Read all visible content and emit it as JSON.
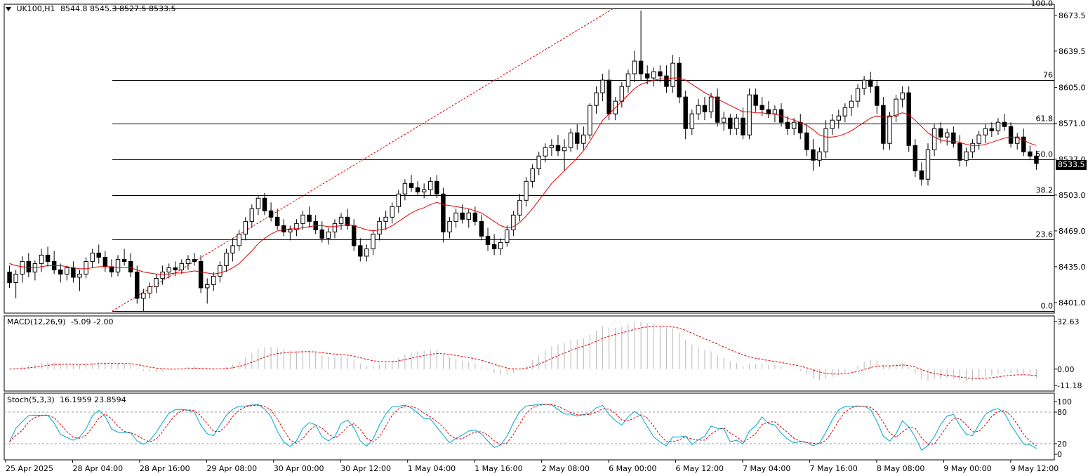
{
  "header": {
    "symbol": "UK100,H1",
    "ohlc": "8544.8 8545.3 8527.5 8533.5"
  },
  "last_price_tag": "8533.5",
  "macd": {
    "label": "MACD(12,26,9)",
    "values": "-5.09 -2.00"
  },
  "stoch": {
    "label": "Stoch(5,3,3)",
    "values": "16.1959 23.8594"
  },
  "colors": {
    "ma": "#e00000",
    "macd_signal": "#e00000",
    "macd_hist": "#b8b8b8",
    "stoch_main": "#00a6c8",
    "stoch_signal": "#e00000",
    "fib": "#000000",
    "trend": "#e00000"
  },
  "chart_data": [
    {
      "type": "candlestick",
      "title": "UK100,H1",
      "price_axis_ticks": [
        "8673.5",
        "8639.5",
        "8605.0",
        "8571.0",
        "8537.0",
        "8503.0",
        "8469.0",
        "8435.0",
        "8401.0"
      ],
      "price_range": [
        8391,
        8684
      ],
      "time_axis_labels": [
        "25 Apr 2025",
        "28 Apr 04:00",
        "28 Apr 16:00",
        "29 Apr 08:00",
        "30 Apr 00:00",
        "30 Apr 12:00",
        "1 May 04:00",
        "1 May 16:00",
        "2 May 08:00",
        "6 May 00:00",
        "6 May 12:00",
        "7 May 04:00",
        "7 May 16:00",
        "8 May 08:00",
        "9 May 00:00",
        "9 May 12:00"
      ],
      "fibonacci_levels": [
        {
          "label": "100.0",
          "price": 8680
        },
        {
          "label": "76",
          "price": 8612
        },
        {
          "label": "61.8",
          "price": 8571
        },
        {
          "label": "50.0",
          "price": 8537
        },
        {
          "label": "38.2",
          "price": 8503
        },
        {
          "label": "23.6",
          "price": 8461
        },
        {
          "label": "0.0",
          "price": 8393
        }
      ],
      "ohlc": [
        [
          8430,
          8436,
          8415,
          8420
        ],
        [
          8420,
          8432,
          8405,
          8428
        ],
        [
          8428,
          8445,
          8420,
          8440
        ],
        [
          8440,
          8448,
          8425,
          8430
        ],
        [
          8430,
          8441,
          8422,
          8438
        ],
        [
          8438,
          8452,
          8430,
          8446
        ],
        [
          8446,
          8454,
          8435,
          8440
        ],
        [
          8440,
          8450,
          8428,
          8432
        ],
        [
          8432,
          8438,
          8420,
          8428
        ],
        [
          8428,
          8436,
          8422,
          8434
        ],
        [
          8434,
          8440,
          8420,
          8425
        ],
        [
          8425,
          8432,
          8412,
          8428
        ],
        [
          8428,
          8444,
          8424,
          8440
        ],
        [
          8440,
          8452,
          8434,
          8448
        ],
        [
          8448,
          8456,
          8438,
          8444
        ],
        [
          8444,
          8450,
          8430,
          8435
        ],
        [
          8435,
          8442,
          8425,
          8430
        ],
        [
          8430,
          8446,
          8426,
          8442
        ],
        [
          8442,
          8452,
          8436,
          8440
        ],
        [
          8440,
          8448,
          8425,
          8430
        ],
        [
          8430,
          8436,
          8400,
          8405
        ],
        [
          8405,
          8414,
          8393,
          8410
        ],
        [
          8410,
          8420,
          8405,
          8416
        ],
        [
          8416,
          8428,
          8410,
          8424
        ],
        [
          8424,
          8436,
          8418,
          8430
        ],
        [
          8430,
          8438,
          8424,
          8434
        ],
        [
          8434,
          8440,
          8426,
          8432
        ],
        [
          8432,
          8442,
          8428,
          8438
        ],
        [
          8438,
          8446,
          8432,
          8442
        ],
        [
          8442,
          8448,
          8436,
          8440
        ],
        [
          8440,
          8446,
          8410,
          8415
        ],
        [
          8415,
          8424,
          8400,
          8418
        ],
        [
          8418,
          8430,
          8412,
          8426
        ],
        [
          8426,
          8440,
          8420,
          8436
        ],
        [
          8436,
          8452,
          8430,
          8448
        ],
        [
          8448,
          8462,
          8440,
          8455
        ],
        [
          8455,
          8470,
          8450,
          8466
        ],
        [
          8466,
          8482,
          8460,
          8478
        ],
        [
          8478,
          8494,
          8472,
          8490
        ],
        [
          8490,
          8503,
          8484,
          8500
        ],
        [
          8500,
          8505,
          8484,
          8488
        ],
        [
          8488,
          8496,
          8478,
          8482
        ],
        [
          8482,
          8490,
          8470,
          8474
        ],
        [
          8474,
          8480,
          8464,
          8468
        ],
        [
          8468,
          8474,
          8460,
          8470
        ],
        [
          8470,
          8480,
          8464,
          8476
        ],
        [
          8476,
          8488,
          8470,
          8484
        ],
        [
          8484,
          8492,
          8472,
          8478
        ],
        [
          8478,
          8484,
          8466,
          8470
        ],
        [
          8470,
          8478,
          8458,
          8462
        ],
        [
          8462,
          8472,
          8456,
          8468
        ],
        [
          8468,
          8480,
          8462,
          8476
        ],
        [
          8476,
          8486,
          8470,
          8482
        ],
        [
          8482,
          8490,
          8470,
          8474
        ],
        [
          8474,
          8480,
          8450,
          8455
        ],
        [
          8455,
          8462,
          8440,
          8445
        ],
        [
          8445,
          8456,
          8440,
          8452
        ],
        [
          8452,
          8470,
          8446,
          8466
        ],
        [
          8466,
          8482,
          8460,
          8478
        ],
        [
          8478,
          8488,
          8470,
          8482
        ],
        [
          8482,
          8496,
          8476,
          8492
        ],
        [
          8492,
          8508,
          8486,
          8504
        ],
        [
          8504,
          8518,
          8498,
          8514
        ],
        [
          8514,
          8522,
          8506,
          8510
        ],
        [
          8510,
          8516,
          8502,
          8506
        ],
        [
          8506,
          8514,
          8500,
          8508
        ],
        [
          8508,
          8520,
          8502,
          8516
        ],
        [
          8516,
          8522,
          8500,
          8504
        ],
        [
          8504,
          8510,
          8458,
          8468
        ],
        [
          8468,
          8482,
          8462,
          8478
        ],
        [
          8478,
          8490,
          8472,
          8486
        ],
        [
          8486,
          8494,
          8476,
          8480
        ],
        [
          8480,
          8490,
          8472,
          8486
        ],
        [
          8486,
          8492,
          8474,
          8478
        ],
        [
          8478,
          8484,
          8460,
          8464
        ],
        [
          8464,
          8472,
          8450,
          8456
        ],
        [
          8456,
          8466,
          8446,
          8452
        ],
        [
          8452,
          8462,
          8446,
          8458
        ],
        [
          8458,
          8474,
          8454,
          8470
        ],
        [
          8470,
          8488,
          8464,
          8484
        ],
        [
          8484,
          8504,
          8478,
          8498
        ],
        [
          8498,
          8520,
          8492,
          8516
        ],
        [
          8516,
          8532,
          8510,
          8528
        ],
        [
          8528,
          8544,
          8522,
          8540
        ],
        [
          8540,
          8552,
          8534,
          8548
        ],
        [
          8548,
          8556,
          8540,
          8550
        ],
        [
          8550,
          8560,
          8540,
          8545
        ],
        [
          8545,
          8556,
          8526,
          8548
        ],
        [
          8548,
          8566,
          8544,
          8562
        ],
        [
          8562,
          8570,
          8546,
          8552
        ],
        [
          8552,
          8568,
          8546,
          8560
        ],
        [
          8560,
          8590,
          8556,
          8588
        ],
        [
          8588,
          8606,
          8580,
          8600
        ],
        [
          8600,
          8618,
          8592,
          8612
        ],
        [
          8612,
          8622,
          8574,
          8580
        ],
        [
          8580,
          8596,
          8574,
          8592
        ],
        [
          8592,
          8610,
          8586,
          8606
        ],
        [
          8606,
          8622,
          8600,
          8618
        ],
        [
          8618,
          8640,
          8610,
          8630
        ],
        [
          8630,
          8678,
          8612,
          8618
        ],
        [
          8618,
          8626,
          8608,
          8614
        ],
        [
          8614,
          8624,
          8606,
          8620
        ],
        [
          8620,
          8626,
          8610,
          8616
        ],
        [
          8616,
          8626,
          8600,
          8606
        ],
        [
          8606,
          8636,
          8600,
          8628
        ],
        [
          8628,
          8634,
          8590,
          8596
        ],
        [
          8596,
          8602,
          8556,
          8566
        ],
        [
          8566,
          8584,
          8560,
          8580
        ],
        [
          8580,
          8594,
          8574,
          8588
        ],
        [
          8588,
          8596,
          8574,
          8582
        ],
        [
          8582,
          8600,
          8576,
          8596
        ],
        [
          8596,
          8604,
          8568,
          8572
        ],
        [
          8572,
          8582,
          8564,
          8576
        ],
        [
          8576,
          8580,
          8560,
          8566
        ],
        [
          8566,
          8580,
          8560,
          8576
        ],
        [
          8576,
          8586,
          8556,
          8560
        ],
        [
          8560,
          8604,
          8556,
          8598
        ],
        [
          8598,
          8604,
          8582,
          8588
        ],
        [
          8588,
          8596,
          8578,
          8584
        ],
        [
          8584,
          8592,
          8576,
          8580
        ],
        [
          8580,
          8588,
          8572,
          8584
        ],
        [
          8584,
          8590,
          8568,
          8572
        ],
        [
          8572,
          8578,
          8560,
          8566
        ],
        [
          8566,
          8576,
          8560,
          8572
        ],
        [
          8572,
          8580,
          8556,
          8562
        ],
        [
          8562,
          8570,
          8540,
          8546
        ],
        [
          8546,
          8556,
          8526,
          8536
        ],
        [
          8536,
          8548,
          8530,
          8544
        ],
        [
          8544,
          8574,
          8538,
          8566
        ],
        [
          8566,
          8580,
          8560,
          8574
        ],
        [
          8574,
          8584,
          8566,
          8578
        ],
        [
          8578,
          8590,
          8572,
          8586
        ],
        [
          8586,
          8598,
          8578,
          8592
        ],
        [
          8592,
          8608,
          8586,
          8604
        ],
        [
          8604,
          8616,
          8598,
          8612
        ],
        [
          8612,
          8620,
          8600,
          8606
        ],
        [
          8606,
          8612,
          8580,
          8588
        ],
        [
          8588,
          8596,
          8546,
          8552
        ],
        [
          8552,
          8582,
          8546,
          8578
        ],
        [
          8578,
          8598,
          8572,
          8594
        ],
        [
          8594,
          8606,
          8586,
          8600
        ],
        [
          8600,
          8606,
          8544,
          8550
        ],
        [
          8550,
          8556,
          8520,
          8526
        ],
        [
          8526,
          8534,
          8512,
          8518
        ],
        [
          8518,
          8552,
          8512,
          8546
        ],
        [
          8546,
          8570,
          8540,
          8566
        ],
        [
          8566,
          8572,
          8552,
          8558
        ],
        [
          8558,
          8566,
          8550,
          8562
        ],
        [
          8562,
          8568,
          8548,
          8552
        ],
        [
          8552,
          8560,
          8530,
          8536
        ],
        [
          8536,
          8548,
          8530,
          8544
        ],
        [
          8544,
          8556,
          8538,
          8552
        ],
        [
          8552,
          8564,
          8546,
          8560
        ],
        [
          8560,
          8570,
          8552,
          8566
        ],
        [
          8566,
          8572,
          8558,
          8564
        ],
        [
          8564,
          8576,
          8560,
          8572
        ],
        [
          8572,
          8580,
          8564,
          8568
        ],
        [
          8568,
          8572,
          8548,
          8552
        ],
        [
          8552,
          8562,
          8546,
          8558
        ],
        [
          8558,
          8566,
          8540,
          8544
        ],
        [
          8544,
          8550,
          8536,
          8540
        ],
        [
          8540,
          8545,
          8527,
          8533
        ]
      ],
      "ma": [
        8438,
        8436,
        8435,
        8434,
        8434,
        8435,
        8436,
        8436,
        8436,
        8435,
        8434,
        8433,
        8433,
        8434,
        8435,
        8435,
        8435,
        8434,
        8434,
        8434,
        8432,
        8430,
        8429,
        8428,
        8428,
        8428,
        8429,
        8429,
        8430,
        8431,
        8430,
        8429,
        8428,
        8429,
        8431,
        8434,
        8438,
        8444,
        8450,
        8457,
        8462,
        8466,
        8469,
        8470,
        8471,
        8471,
        8472,
        8473,
        8474,
        8474,
        8473,
        8473,
        8474,
        8475,
        8474,
        8472,
        8470,
        8469,
        8470,
        8471,
        8474,
        8478,
        8482,
        8486,
        8489,
        8491,
        8494,
        8496,
        8494,
        8493,
        8492,
        8491,
        8490,
        8488,
        8486,
        8482,
        8478,
        8474,
        8472,
        8473,
        8477,
        8483,
        8490,
        8498,
        8506,
        8514,
        8520,
        8526,
        8532,
        8538,
        8545,
        8554,
        8564,
        8574,
        8580,
        8586,
        8592,
        8598,
        8604,
        8608,
        8610,
        8612,
        8613,
        8613,
        8614,
        8614,
        8612,
        8608,
        8604,
        8600,
        8597,
        8594,
        8591,
        8588,
        8585,
        8582,
        8582,
        8581,
        8581,
        8580,
        8580,
        8578,
        8576,
        8574,
        8572,
        8569,
        8565,
        8560,
        8558,
        8558,
        8559,
        8561,
        8564,
        8568,
        8572,
        8576,
        8578,
        8577,
        8577,
        8579,
        8581,
        8579,
        8574,
        8568,
        8562,
        8558,
        8555,
        8554,
        8554,
        8553,
        8551,
        8550,
        8550,
        8551,
        8553,
        8555,
        8557,
        8558,
        8557,
        8555,
        8552,
        8550
      ],
      "macd_range": [
        -11.18,
        32.63
      ],
      "macd_ticks": [
        "32.63",
        "0.00",
        "-11.18"
      ],
      "stoch_range": [
        0,
        100
      ],
      "stoch_ticks": [
        "100",
        "80",
        "20",
        "0"
      ],
      "stoch_levels": [
        80,
        20
      ]
    }
  ]
}
